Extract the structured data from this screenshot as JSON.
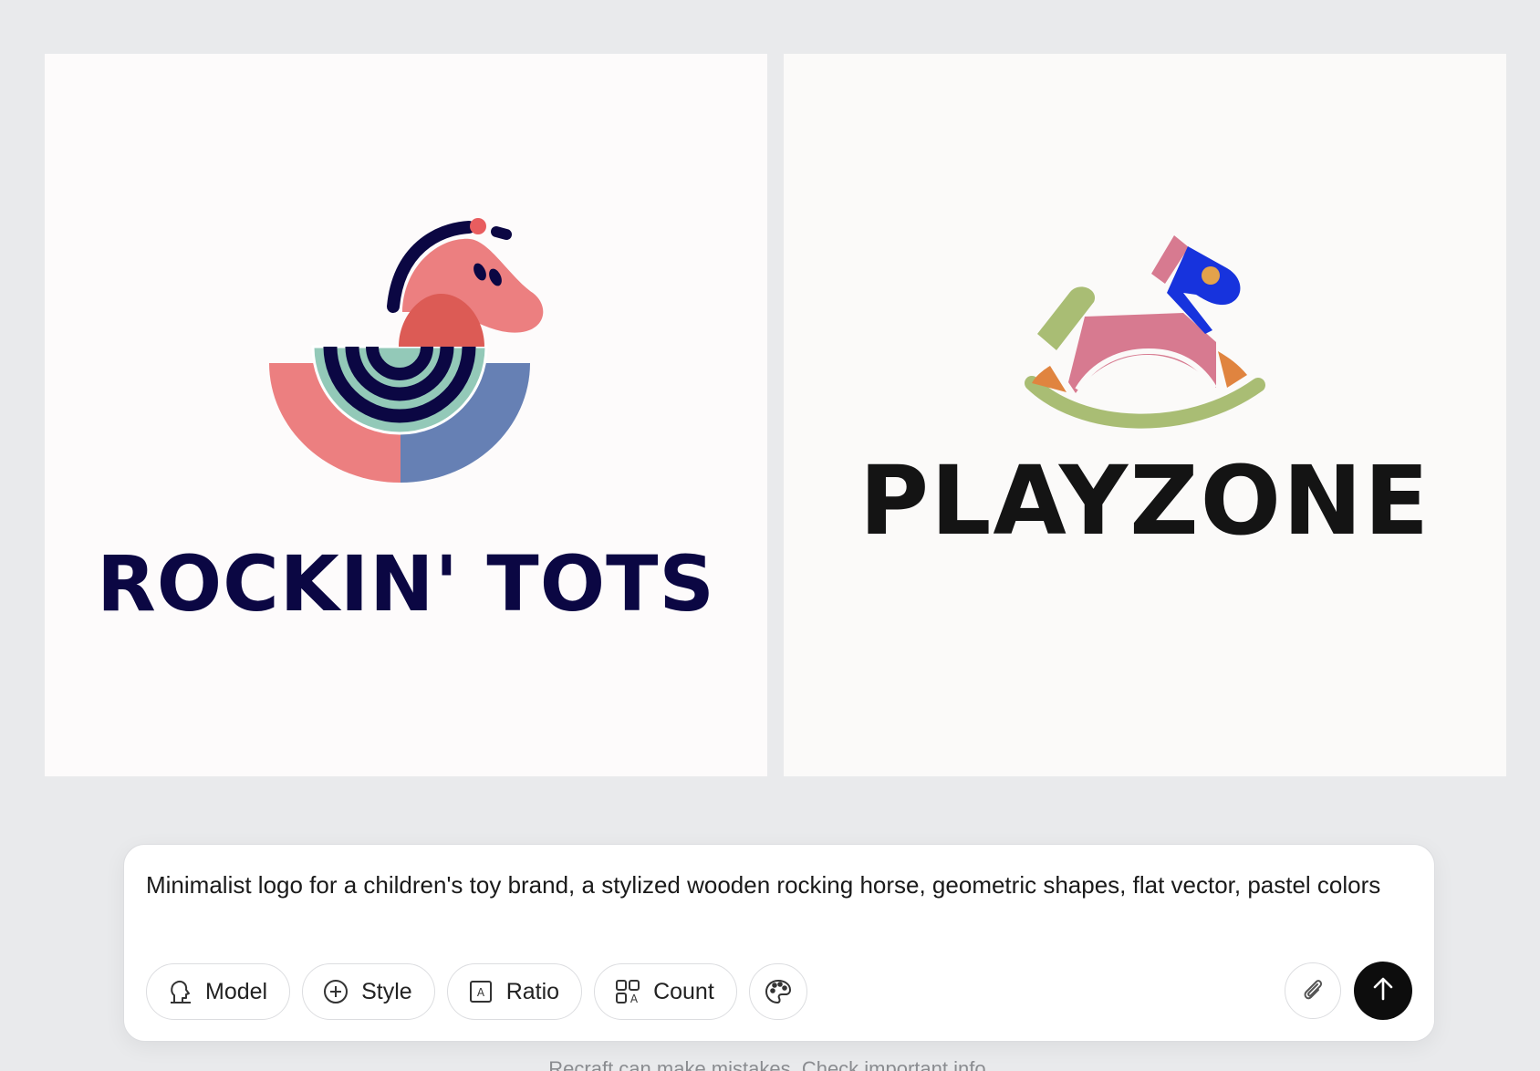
{
  "gallery": {
    "images": [
      {
        "brand_text": "ROCKIN' TOTS"
      },
      {
        "brand_text": "PLAYZONE"
      }
    ]
  },
  "composer": {
    "prompt": "Minimalist logo for a children's toy brand, a stylized wooden rocking horse, geometric shapes, flat vector, pastel colors",
    "buttons": {
      "model": "Model",
      "style": "Style",
      "ratio": "Ratio",
      "count": "Count"
    }
  },
  "footer": {
    "disclaimer": "Recraft can make mistakes. Check important info."
  },
  "icons": [
    "model-icon",
    "plus-circle-icon",
    "ratio-icon",
    "count-grid-icon",
    "palette-icon",
    "paperclip-icon",
    "arrow-up-icon"
  ],
  "colors": {
    "background": "#e9eaec",
    "send_button": "#0d0d0d",
    "navy": "#0b0743",
    "coral": "#ec7f80",
    "mint": "#93c9b8",
    "slate_blue": "#6680b4",
    "pink": "#d77a90",
    "royal_blue": "#1733dd",
    "olive_green": "#a9bd74",
    "orange": "#e0843f"
  }
}
